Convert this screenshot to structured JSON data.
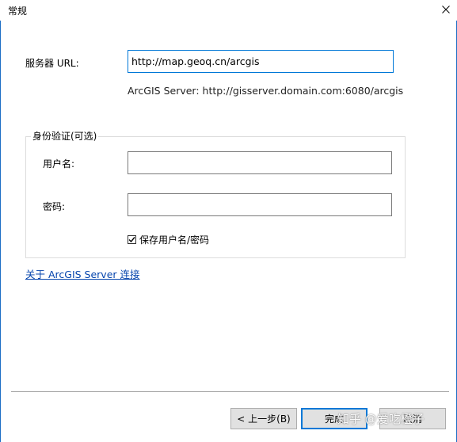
{
  "window": {
    "title": "常规",
    "close_icon": "✕"
  },
  "server": {
    "label": "服务器 URL:",
    "url_value": "http://map.geoq.cn/arcgis",
    "example": "ArcGIS Server: http://gisserver.domain.com:6080/arcgis"
  },
  "auth": {
    "group_title": "身份验证(可选)",
    "username_label": "用户名:",
    "username_value": "",
    "password_label": "密码:",
    "password_value": "",
    "save_checkbox_label": "保存用户名/密码",
    "save_checked": true
  },
  "about_link": "关于 ArcGIS Server 连接",
  "buttons": {
    "back": "< 上一步(B)",
    "finish": "完成",
    "cancel": "取消"
  },
  "watermark": "知乎 @爱吃橙子",
  "colors": {
    "focus_border": "#0078d7",
    "link": "#0645ad",
    "window_border": "#1c6ec5"
  }
}
